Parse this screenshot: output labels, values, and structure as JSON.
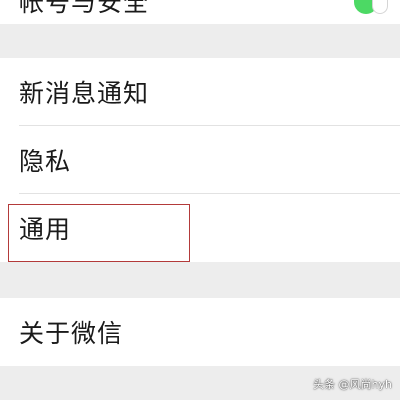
{
  "top_row": {
    "label": "帐号与安全",
    "toggle_on": true,
    "toggle_color": "#4cd964"
  },
  "group1": {
    "items": [
      {
        "label": "新消息通知"
      },
      {
        "label": "隐私"
      },
      {
        "label": "通用"
      }
    ]
  },
  "group2": {
    "items": [
      {
        "label": "关于微信"
      }
    ]
  },
  "highlight": {
    "target": "通用",
    "color": "#b33a3a"
  },
  "watermark": {
    "text": "头条 @风尚hyh"
  }
}
